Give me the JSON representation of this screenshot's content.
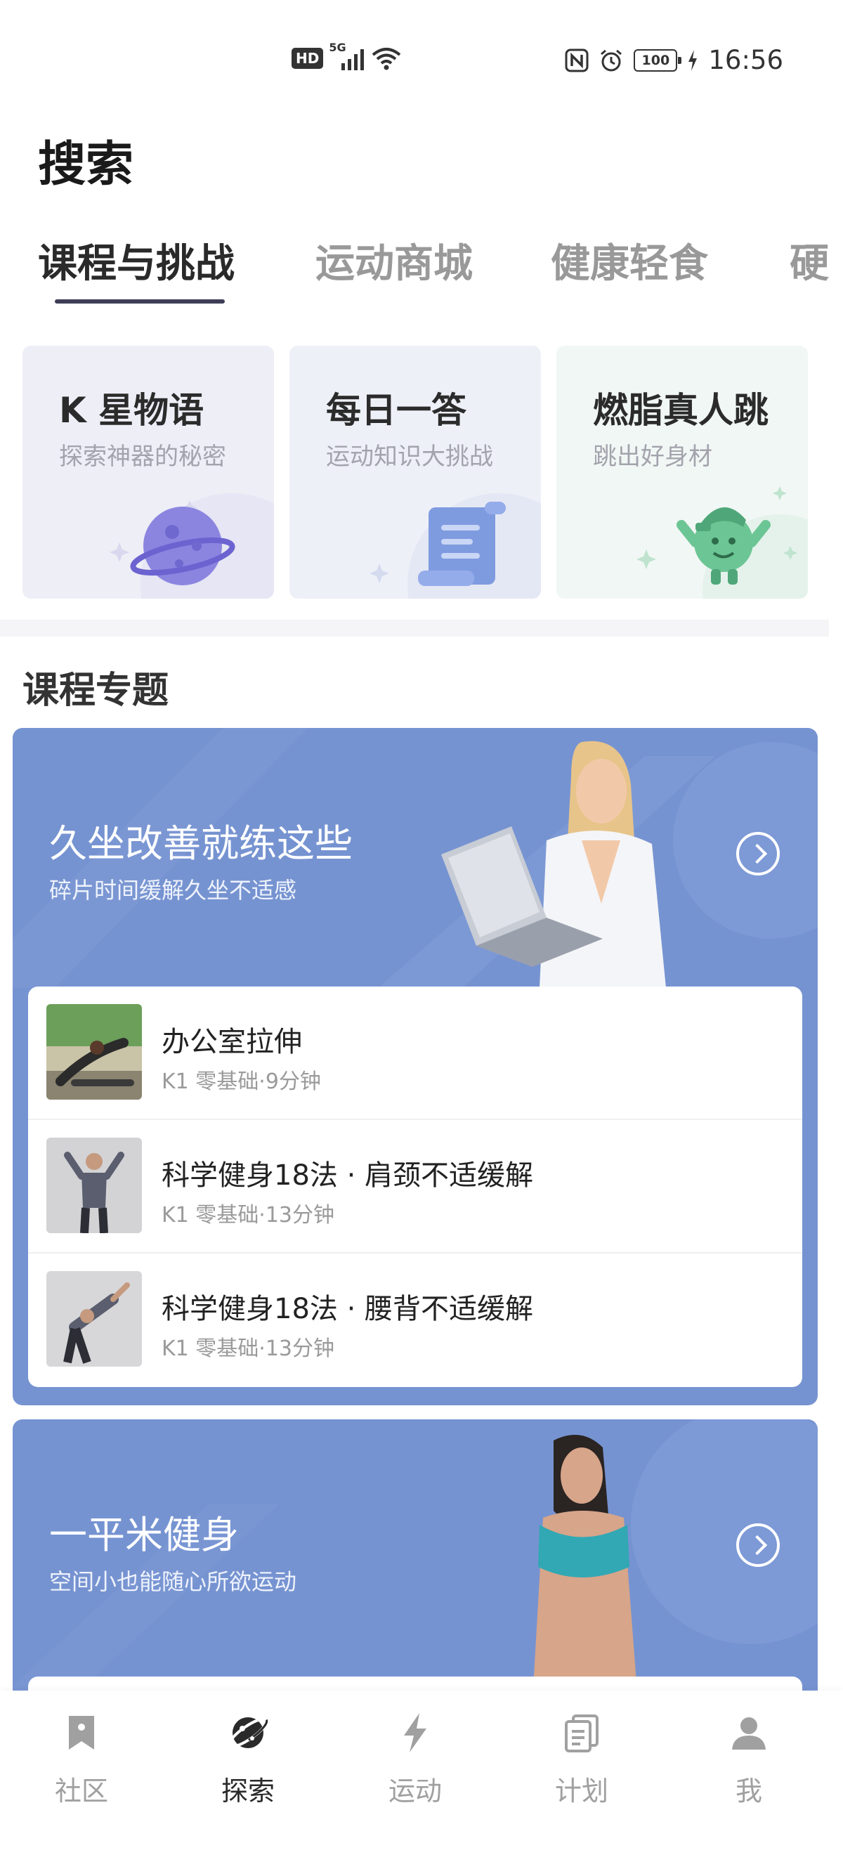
{
  "status_bar": {
    "hd": "HD",
    "network": "5G",
    "battery": "100",
    "time": "16:56"
  },
  "page": {
    "title": "搜索"
  },
  "tabs": [
    {
      "label": "课程与挑战",
      "active": true
    },
    {
      "label": "运动商城",
      "active": false
    },
    {
      "label": "健康轻食",
      "active": false
    },
    {
      "label": "硬",
      "active": false
    }
  ],
  "feature_cards": [
    {
      "title": "K 星物语",
      "subtitle": "探索神器的秘密",
      "icon": "planet-icon",
      "bg": "#eeeef7"
    },
    {
      "title": "每日一答",
      "subtitle": "运动知识大挑战",
      "icon": "scroll-icon",
      "bg": "#eef0f8"
    },
    {
      "title": "燃脂真人跳",
      "subtitle": "跳出好身材",
      "icon": "mascot-icon",
      "bg": "#f1f7f4"
    }
  ],
  "section": {
    "title": "课程专题"
  },
  "banners": [
    {
      "title": "久坐改善就练这些",
      "subtitle": "碎片时间缓解久坐不适感",
      "courses": [
        {
          "title": "办公室拉伸",
          "meta": "K1 零基础·9分钟"
        },
        {
          "title": "科学健身18法 · 肩颈不适缓解",
          "meta": "K1 零基础·13分钟"
        },
        {
          "title": "科学健身18法 · 腰背不适缓解",
          "meta": "K1 零基础·13分钟"
        }
      ]
    },
    {
      "title": "一平米健身",
      "subtitle": "空间小也能随心所欲运动"
    }
  ],
  "bottom_nav": [
    {
      "label": "社区",
      "icon": "community-icon",
      "active": false
    },
    {
      "label": "探索",
      "icon": "explore-icon",
      "active": true
    },
    {
      "label": "运动",
      "icon": "lightning-icon",
      "active": false
    },
    {
      "label": "计划",
      "icon": "plan-icon",
      "active": false
    },
    {
      "label": "我",
      "icon": "profile-icon",
      "active": false
    }
  ],
  "colors": {
    "accent": "#3f3d57",
    "banner_bg": "#7693d1",
    "muted_text": "#9a9a9a"
  }
}
